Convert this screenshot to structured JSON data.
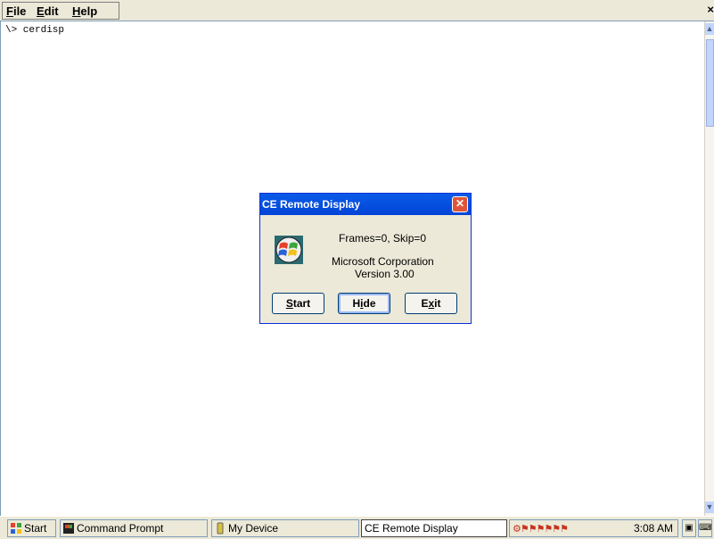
{
  "menu": {
    "file": {
      "hot": "F",
      "rest": "ile"
    },
    "edit": {
      "hot": "E",
      "rest": "dit"
    },
    "help": {
      "hot": "H",
      "rest": "elp"
    },
    "close_glyph": "×"
  },
  "console": {
    "line1": "\\> cerdisp"
  },
  "dialog": {
    "title": "CE Remote Display",
    "close_glyph": "✕",
    "stats": "Frames=0, Skip=0",
    "company": "Microsoft Corporation",
    "version": "Version 3.00",
    "buttons": {
      "start": {
        "hot": "S",
        "rest": "tart"
      },
      "hide": {
        "pre": "H",
        "hot": "i",
        "rest": "de"
      },
      "exit": {
        "pre": "E",
        "hot": "x",
        "rest": "it"
      }
    }
  },
  "taskbar": {
    "start_label": "Start",
    "items": [
      "Command Prompt",
      "My Device",
      "CE Remote Display"
    ],
    "clock": "3:08 AM"
  },
  "colors": {
    "title_blue": "#0a5ce8",
    "close_red": "#e0553a",
    "accent": "#0831d9"
  }
}
